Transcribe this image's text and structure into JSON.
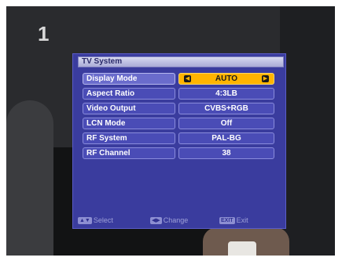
{
  "overlay": {
    "channel_logo": "1"
  },
  "osd": {
    "title": "TV System",
    "rows": [
      {
        "label": "Display Mode",
        "value": "AUTO",
        "selected": true
      },
      {
        "label": "Aspect Ratio",
        "value": "4:3LB"
      },
      {
        "label": "Video Output",
        "value": "CVBS+RGB"
      },
      {
        "label": "LCN Mode",
        "value": "Off"
      },
      {
        "label": "RF System",
        "value": "PAL-BG"
      },
      {
        "label": "RF Channel",
        "value": "38"
      }
    ],
    "footer": {
      "select_key": "▲▼",
      "select_label": "Select",
      "change_key": "◀▶",
      "change_label": "Change",
      "exit_key": "EXIT",
      "exit_label": "Exit"
    },
    "colors": {
      "panel": "#3a3c9e",
      "selected_value": "#ffb400",
      "row": "#4a4cb6"
    }
  }
}
